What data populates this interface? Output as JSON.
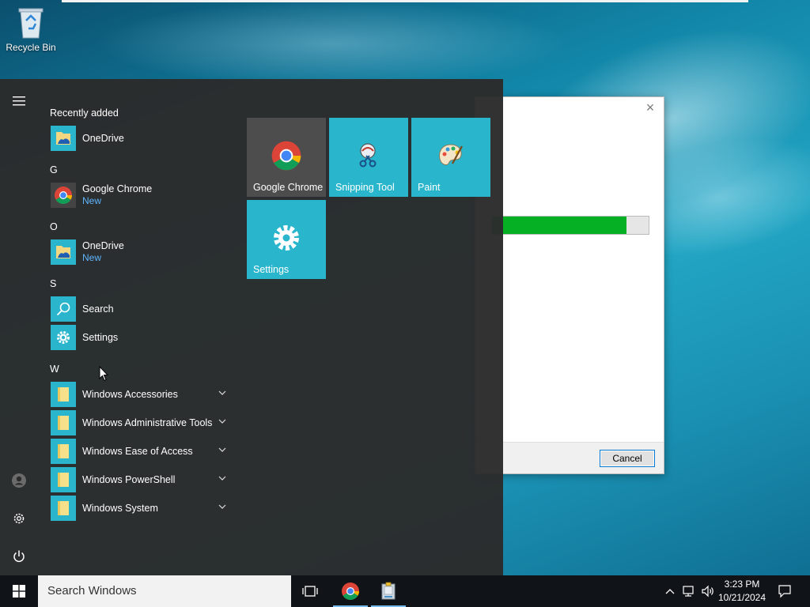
{
  "desktop": {
    "icons": [
      {
        "label": "Recycle Bin",
        "icon": "recycle-bin-icon"
      }
    ]
  },
  "dialog": {
    "progress": 0.86,
    "cancel_label": "Cancel",
    "close_glyph": "×",
    "accent": "#06b025"
  },
  "start_menu": {
    "sections": [
      {
        "header": "Recently added",
        "items": [
          {
            "label": "OneDrive",
            "sub": "",
            "icon": "onedrive-icon"
          }
        ]
      },
      {
        "header": "G",
        "items": [
          {
            "label": "Google Chrome",
            "sub": "New",
            "icon": "chrome-icon"
          }
        ]
      },
      {
        "header": "O",
        "items": [
          {
            "label": "OneDrive",
            "sub": "New",
            "icon": "onedrive-icon"
          }
        ]
      },
      {
        "header": "S",
        "items": [
          {
            "label": "Search",
            "sub": "",
            "icon": "search-icon"
          },
          {
            "label": "Settings",
            "sub": "",
            "icon": "gear-icon"
          }
        ]
      },
      {
        "header": "W",
        "items": [
          {
            "label": "Windows Accessories",
            "sub": "",
            "icon": "folder-icon",
            "expandable": true
          },
          {
            "label": "Windows Administrative Tools",
            "sub": "",
            "icon": "folder-icon",
            "expandable": true
          },
          {
            "label": "Windows Ease of Access",
            "sub": "",
            "icon": "folder-icon",
            "expandable": true
          },
          {
            "label": "Windows PowerShell",
            "sub": "",
            "icon": "folder-icon",
            "expandable": true
          },
          {
            "label": "Windows System",
            "sub": "",
            "icon": "folder-icon",
            "expandable": true
          }
        ]
      }
    ],
    "tiles": [
      {
        "label": "Google Chrome",
        "icon": "chrome-icon",
        "color": "#4d4d4d"
      },
      {
        "label": "Snipping Tool",
        "icon": "snipping-tool-icon",
        "color": "#29b6cc"
      },
      {
        "label": "Paint",
        "icon": "paint-palette-icon",
        "color": "#29b6cc"
      },
      {
        "label": "Settings",
        "icon": "gear-icon",
        "color": "#29b6cc"
      }
    ],
    "rail": [
      "hamburger-menu-icon",
      "user-account-icon",
      "gear-icon",
      "power-icon"
    ]
  },
  "taskbar": {
    "search_placeholder": "Search Windows",
    "pinned": [
      "task-view-icon",
      "chrome-icon",
      "installer-icon"
    ],
    "tray": [
      "chevron-up-icon",
      "network-icon",
      "volume-icon"
    ],
    "time": "3:23 PM",
    "date": "10/21/2024",
    "accent": "#76b9ed"
  }
}
